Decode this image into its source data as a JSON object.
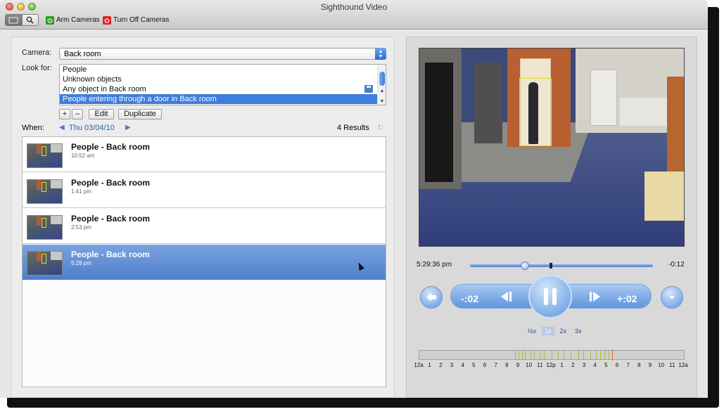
{
  "window": {
    "title": "Sighthound Video"
  },
  "toolbar": {
    "arm_label": "Arm Cameras",
    "off_label": "Turn Off Cameras"
  },
  "search": {
    "camera_label": "Camera:",
    "camera_value": "Back room",
    "look_label": "Look for:",
    "look_items": [
      "People",
      "Unknown objects",
      "Any object in Back room",
      "People entering through a door in Back room"
    ],
    "selected_look_index": 3,
    "add_label": "+",
    "remove_label": "–",
    "edit_label": "Edit",
    "duplicate_label": "Duplicate",
    "when_label": "When:",
    "date": "Thu 03/04/10",
    "results_count": "4 Results"
  },
  "results": [
    {
      "title": "People - Back room",
      "time": "10:52 am",
      "selected": false
    },
    {
      "title": "People - Back room",
      "time": "1:41 pm",
      "selected": false
    },
    {
      "title": "People - Back room",
      "time": "2:53 pm",
      "selected": false
    },
    {
      "title": "People - Back room",
      "time": "5:29 pm",
      "selected": true
    }
  ],
  "player": {
    "current_time": "5:29:36 pm",
    "remaining": "-0:12",
    "position_fraction": 0.3,
    "back_label": "-:02",
    "forward_label": "+:02",
    "speeds": [
      "½x",
      "1x",
      "2x",
      "3x"
    ],
    "active_speed": "1x"
  },
  "timeline": {
    "hours": [
      "12a",
      "1",
      "2",
      "3",
      "4",
      "5",
      "6",
      "7",
      "8",
      "9",
      "10",
      "11",
      "12p",
      "1",
      "2",
      "3",
      "4",
      "5",
      "6",
      "7",
      "8",
      "9",
      "10",
      "11",
      "12a"
    ],
    "event_hours": [
      8.7,
      9.0,
      9.3,
      9.6,
      10.1,
      10.4,
      10.9,
      11.3,
      12.0,
      12.6,
      13.1,
      13.7,
      14.4,
      14.9,
      15.5,
      16.0,
      16.4,
      16.8,
      17.2
    ],
    "now_hour": 17.5
  },
  "colors": {
    "accent": "#3d7ddb",
    "event": "#9cc03a",
    "now": "#e86b2a"
  }
}
